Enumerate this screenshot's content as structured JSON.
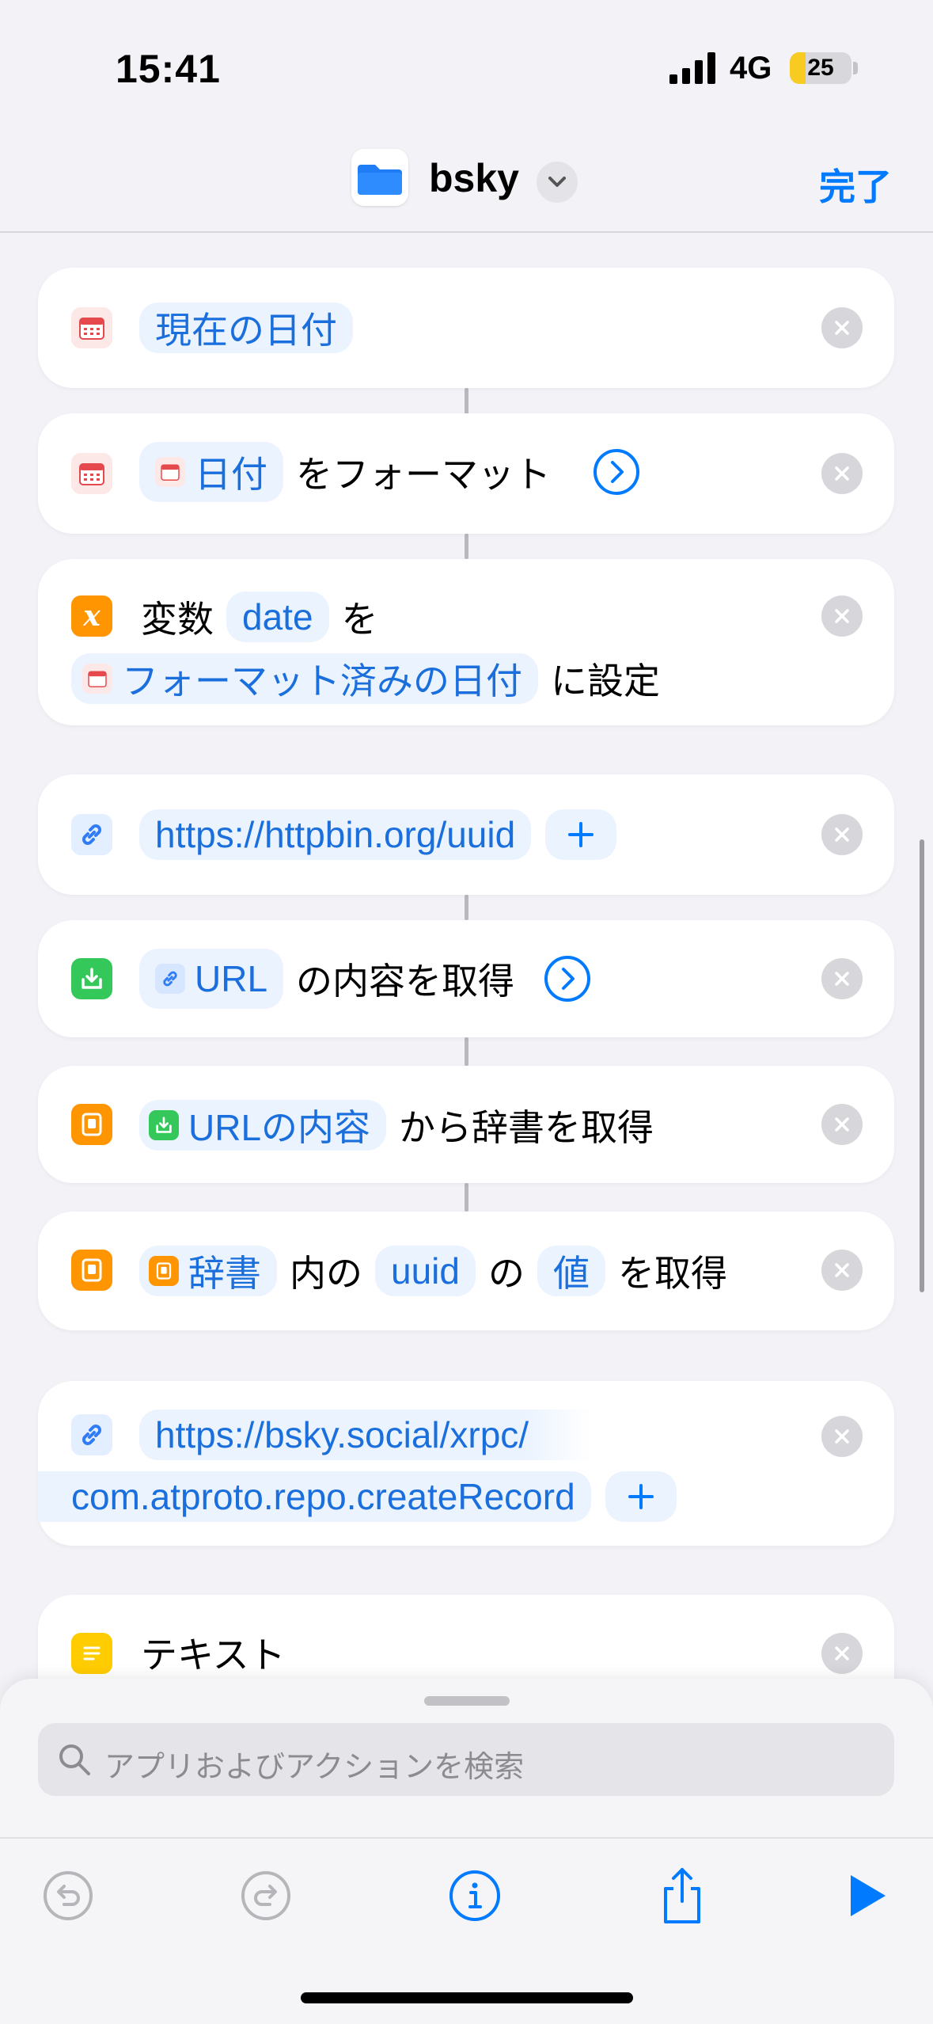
{
  "status_bar": {
    "time": "15:41",
    "network": "4G",
    "battery": "25",
    "battery_level": 0.25
  },
  "nav": {
    "title": "bsky",
    "done_label": "完了"
  },
  "actions": {
    "current_date": {
      "token": "現在の日付"
    },
    "format_date": {
      "token": "日付",
      "text": "をフォーマット"
    },
    "set_variable": {
      "label": "変数",
      "var_name": "date",
      "text_wo": "を",
      "token": "フォーマット済みの日付",
      "text_set": "に設定"
    },
    "url1": {
      "token": "https://httpbin.org/uuid"
    },
    "get_contents": {
      "token": "URL",
      "text": "の内容を取得"
    },
    "get_dict": {
      "token": "URLの内容",
      "text": "から辞書を取得"
    },
    "get_value": {
      "token_dict": "辞書",
      "text_in": "内の",
      "token_key": "uuid",
      "text_no": "の",
      "token_value": "値",
      "text_get": "を取得"
    },
    "url2": {
      "line1": "https://bsky.social/xrpc/",
      "line2": "com.atproto.repo.createRecord"
    },
    "text_action": {
      "label": "テキスト"
    }
  },
  "search": {
    "placeholder": "アプリおよびアクションを検索"
  },
  "colors": {
    "accent": "#007aff",
    "token_bg": "#ebf3ff",
    "token_text": "#1a6fdc"
  }
}
